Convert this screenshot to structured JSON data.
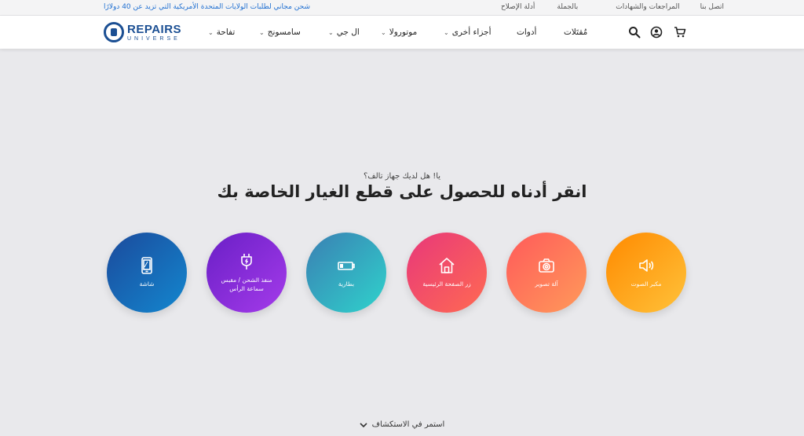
{
  "topbar": {
    "promo": "شحن مجاني لطلبات الولايات المتحدة الأمريكية التي تزيد عن 40 دولارًا",
    "links": [
      "اتصل بنا",
      "المراجعات والشهادات",
      "بالجملة",
      "أدلة الإصلاح"
    ]
  },
  "logo": {
    "word": "REPAIRS",
    "sub": "UNIVERSE"
  },
  "nav": {
    "items": [
      {
        "label": "مُقتَلات",
        "chevron": false
      },
      {
        "label": "أدوات",
        "chevron": false
      },
      {
        "label": "أجزاء أخرى",
        "chevron": true
      },
      {
        "label": "موتورولا",
        "chevron": true
      },
      {
        "label": "ال جي",
        "chevron": true
      },
      {
        "label": "سامسونج",
        "chevron": true
      },
      {
        "label": "تفاحة",
        "chevron": true
      }
    ]
  },
  "hero": {
    "eyebrow": "يا! هل لديك جهاز تالف؟",
    "headline": "انقر أدناه للحصول على قطع الغيار الخاصة بك",
    "categories": [
      {
        "label": "مكبر الصوت",
        "icon": "speaker-icon"
      },
      {
        "label": "آلة تصوير",
        "icon": "camera-icon"
      },
      {
        "label": "زر الصفحة الرئيسية",
        "icon": "home-icon"
      },
      {
        "label": "بطارية",
        "icon": "battery-icon"
      },
      {
        "label": "منفذ الشحن / مقبس سماعة الرأس",
        "icon": "charging-plug-icon"
      },
      {
        "label": "شاشة",
        "icon": "phone-screen-icon"
      }
    ],
    "more": "استمر في الاستكشاف"
  },
  "colors": {
    "brand": "#1b4f93",
    "promo": "#1f6fd1"
  }
}
